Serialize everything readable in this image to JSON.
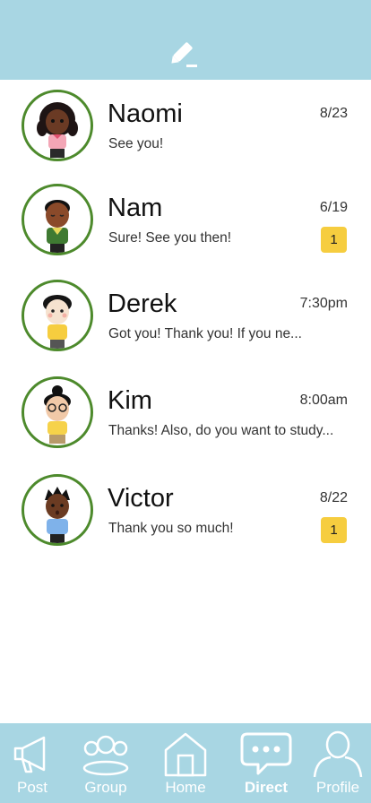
{
  "header": {
    "compose_icon": "edit-pencil-icon",
    "background": "#a8d6e3"
  },
  "conversations": [
    {
      "name": "Naomi",
      "time": "8/23",
      "preview": "See you!",
      "unread": ""
    },
    {
      "name": "Nam",
      "time": "6/19",
      "preview": "Sure! See you then!",
      "unread": "1"
    },
    {
      "name": "Derek",
      "time": "7:30pm",
      "preview": "Got you! Thank you! If you ne...",
      "unread": ""
    },
    {
      "name": "Kim",
      "time": "8:00am",
      "preview": "Thanks! Also, do you want to study...",
      "unread": ""
    },
    {
      "name": "Victor",
      "time": "8/22",
      "preview": "Thank you so much!",
      "unread": "1"
    }
  ],
  "tabbar": {
    "tabs": [
      {
        "label": "Post",
        "icon": "megaphone-icon"
      },
      {
        "label": "Group",
        "icon": "group-icon"
      },
      {
        "label": "Home",
        "icon": "home-icon"
      },
      {
        "label": "Direct",
        "icon": "chat-bubble-icon",
        "active": true
      },
      {
        "label": "Profile",
        "icon": "profile-icon"
      }
    ]
  },
  "colors": {
    "accent": "#a8d6e3",
    "avatar_ring": "#4d8a2c",
    "badge": "#f6cd3f"
  }
}
